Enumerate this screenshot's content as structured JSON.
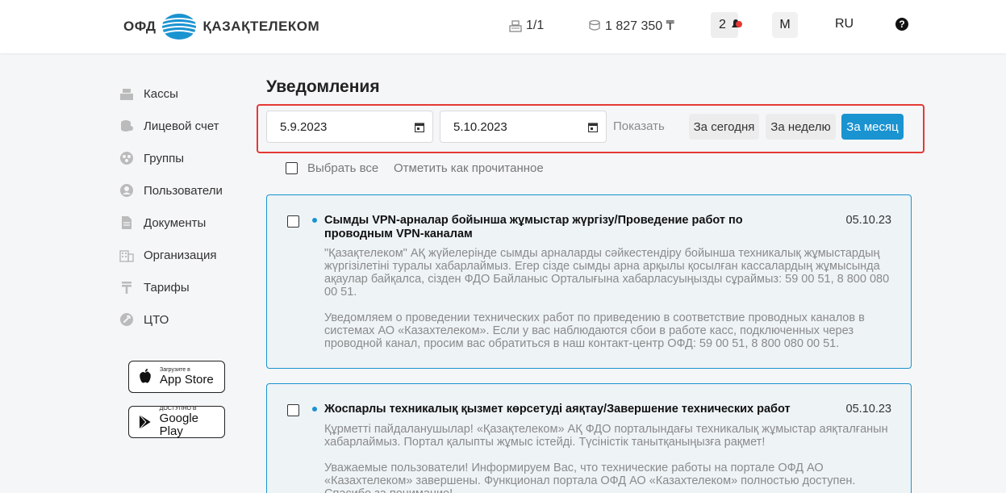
{
  "header": {
    "logo_prefix": "ОФД",
    "logo_name": "ҚАЗАҚТЕЛЕКОМ",
    "cash_registers": "1/1",
    "balance": "1 827 350 ₸",
    "notifications_count": "2",
    "user_initial": "M",
    "language": "RU",
    "help": "?"
  },
  "sidebar": {
    "items": [
      {
        "label": "Кассы",
        "icon": "cash-register-icon"
      },
      {
        "label": "Лицевой счет",
        "icon": "coins-icon"
      },
      {
        "label": "Группы",
        "icon": "groups-icon"
      },
      {
        "label": "Пользователи",
        "icon": "user-icon"
      },
      {
        "label": "Документы",
        "icon": "document-icon"
      },
      {
        "label": "Организация",
        "icon": "building-icon"
      },
      {
        "label": "Тарифы",
        "icon": "tenge-icon"
      },
      {
        "label": "ЦТО",
        "icon": "wrench-icon"
      }
    ],
    "app_store": {
      "small": "Загрузите в",
      "big": "App Store"
    },
    "google_play": {
      "small": "ДОСТУПНО В",
      "big": "Google Play"
    }
  },
  "main": {
    "title": "Уведомления",
    "filter": {
      "date_from": "5.9.2023",
      "date_to": "5.10.2023",
      "show": "Показать",
      "today": "За сегодня",
      "week": "За неделю",
      "month": "За месяц"
    },
    "select_all": "Выбрать все",
    "mark_read": "Отметить как прочитанное",
    "notifications": [
      {
        "title": "Сымды VPN-арналар бойынша жұмыстар жүргізу/Проведение работ по проводным VPN-каналам",
        "date": "05.10.23",
        "text_kz": "\"Қазақтелеком\" АҚ жүйелерінде сымды арналарды сәйкестендіру бойынша техникалық жұмыстардың жүргізілетіні туралы хабарлаймыз. Егер сізде сымды арна арқылы қосылған кассалардың жұмысында ақаулар байқалса, сізден ФДО Байланыс Орталығына хабарласуыңызды сұраймыз: 59 00 51, 8 800 080 00 51.",
        "text_ru": "Уведомляем о проведении технических работ по приведению в соответствие проводных каналов в системах АО «Казахтелеком». Если у вас наблюдаются сбои в работе касс, подключенных через проводной канал, просим вас обратиться в наш контакт-центр ОФД: 59 00 51, 8 800 080 00 51."
      },
      {
        "title": "Жоспарлы техникалық қызмет көрсетуді аяқтау/Завершение технических работ",
        "date": "05.10.23",
        "text_kz": "Құрметті пайдаланушылар! «Қазақтелеком» АҚ ФДО порталындағы техникалық жұмыстар аяқталғанын хабарлаймыз. Портал қалыпты жұмыс істейді. Түсіністік танытқаныңызға рақмет!",
        "text_ru": "Уважаемые пользователи! Информируем Вас, что технические работы на портале ОФД АО «Казахтелеком» завершены. Функционал портала ОФД АО «Казахтелеком» полностью доступен. Спасибо за понимание!"
      }
    ]
  },
  "colors": {
    "accent": "#1a93d1",
    "highlight_border": "#e53935",
    "card_bg": "#eef3f6"
  }
}
